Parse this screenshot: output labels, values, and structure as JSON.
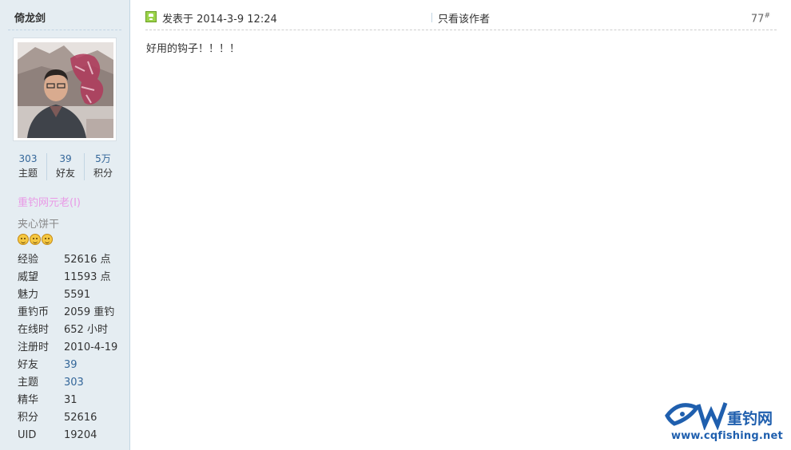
{
  "author": {
    "name": "倚龙剑",
    "stats": [
      {
        "value": "303",
        "label": "主题"
      },
      {
        "value": "39",
        "label": "好友"
      },
      {
        "value": "5万",
        "label": "积分"
      }
    ],
    "group": "重钓网元老(I)",
    "subgroup": "夹心饼干",
    "star_icons": [
      "smile-icon",
      "smile-icon",
      "smile-icon"
    ],
    "info": [
      {
        "key": "经验",
        "value": "52616 点",
        "link": false
      },
      {
        "key": "威望",
        "value": "11593 点",
        "link": false
      },
      {
        "key": "魅力",
        "value": "5591",
        "link": false
      },
      {
        "key": "重钓币",
        "value": "2059 重钓",
        "link": false
      },
      {
        "key": "在线时",
        "value": "652 小时",
        "link": false
      },
      {
        "key": "注册时",
        "value": "2010-4-19",
        "link": false
      },
      {
        "key": "好友",
        "value": "39",
        "link": true
      },
      {
        "key": "主题",
        "value": "303",
        "link": true
      },
      {
        "key": "精华",
        "value": "31",
        "link": false
      },
      {
        "key": "积分",
        "value": "52616",
        "link": false
      },
      {
        "key": "UID",
        "value": "19204",
        "link": false
      }
    ]
  },
  "post": {
    "posted_at": "发表于 2014-3-9 12:24",
    "only_author": "只看该作者",
    "floor": "77",
    "floor_suffix": "#",
    "content": "好用的钩子！！！！"
  },
  "watermark": {
    "name": "重钓网",
    "url": "www.cqfishing.net"
  },
  "colors": {
    "sidebar_bg": "#e5edf2",
    "link": "#336699",
    "group": "#e99ae6",
    "watermark": "#1f5fae"
  }
}
